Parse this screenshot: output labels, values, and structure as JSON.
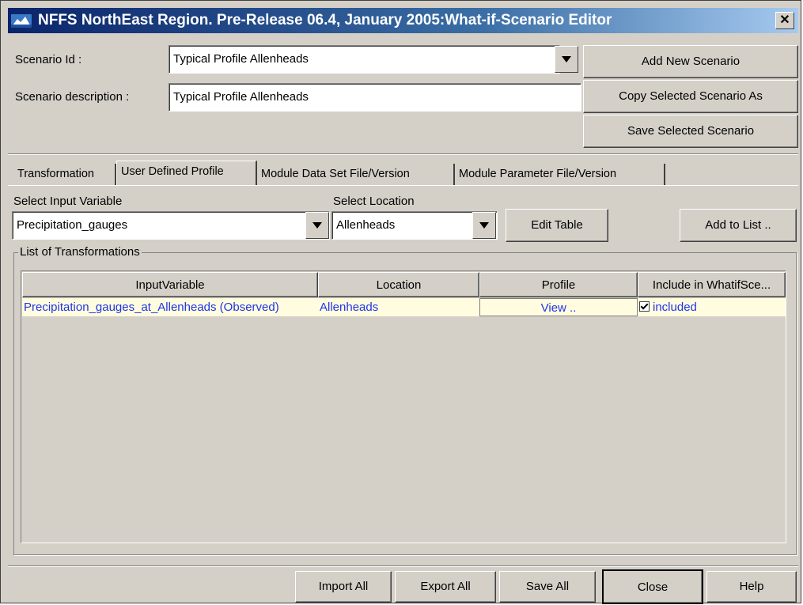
{
  "window": {
    "title": "NFFS NorthEast Region. Pre-Release 06.4, January 2005:What-if-Scenario Editor",
    "close_glyph": "✕"
  },
  "scenario": {
    "id_label": "Scenario Id :",
    "id_value": "Typical Profile Allenheads",
    "desc_label": "Scenario description :",
    "desc_value": "Typical Profile Allenheads"
  },
  "side_buttons": {
    "add_new": "Add New Scenario",
    "copy_selected": "Copy Selected Scenario As",
    "save_selected": "Save Selected Scenario"
  },
  "tabs": [
    {
      "label": "Transformation"
    },
    {
      "label": "User Defined Profile"
    },
    {
      "label": "Module Data Set File/Version"
    },
    {
      "label": "Module Parameter File/Version"
    }
  ],
  "inputs": {
    "variable_label": "Select Input Variable",
    "variable_value": "Precipitation_gauges",
    "location_label": "Select Location",
    "location_value": "Allenheads",
    "edit_table": "Edit Table",
    "add_to_list": "Add to List .."
  },
  "transformations": {
    "group_title": "List of Transformations",
    "columns": [
      "InputVariable",
      "Location",
      "Profile",
      "Include in WhatifSce..."
    ],
    "rows": [
      {
        "input_variable": "Precipitation_gauges_at_Allenheads (Observed)",
        "location": "Allenheads",
        "profile": "View ..",
        "include": "included",
        "checked": true
      }
    ]
  },
  "footer": {
    "import_all": "Import All",
    "export_all": "Export All",
    "save_all": "Save All",
    "close": "Close",
    "help": "Help"
  },
  "colors": {
    "title_gradient_start": "#0a246a",
    "face": "#d4d0c8",
    "link_text": "#1f35e8",
    "row_highlight": "#fffce0"
  }
}
